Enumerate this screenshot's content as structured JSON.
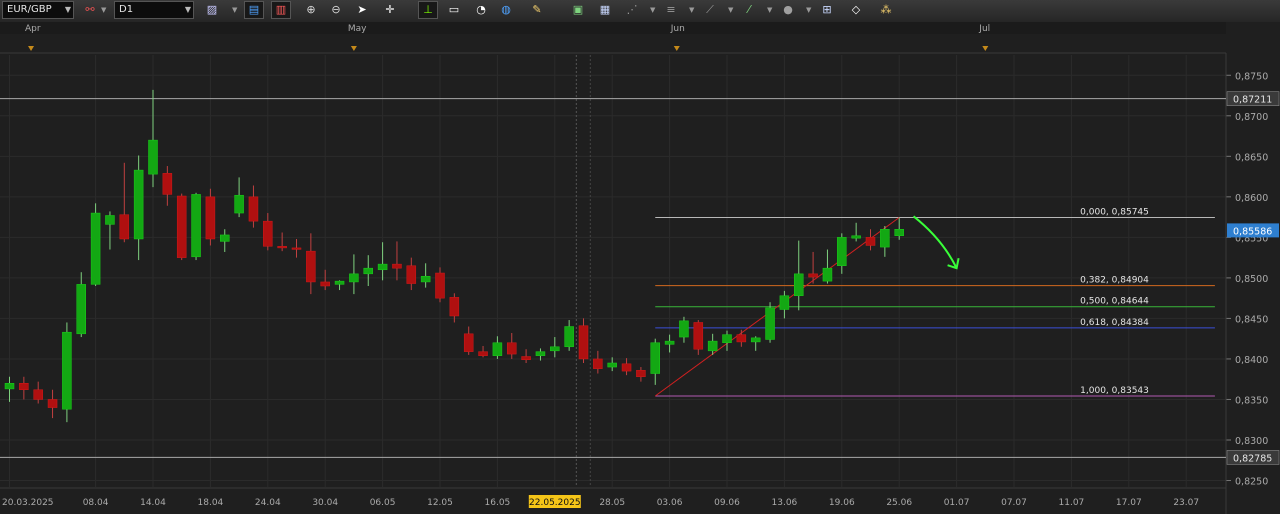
{
  "toolbar": {
    "symbol": "EUR/GBP",
    "timeframe": "D1",
    "icons": [
      {
        "name": "chart-type-icon",
        "glyph": "▨",
        "color": "#c9c9ff"
      },
      {
        "name": "indicator-rsi-icon",
        "glyph": "▤",
        "color": "#4fa3ff"
      },
      {
        "name": "indicator-macd-icon",
        "glyph": "▥",
        "color": "#ff5a5a"
      },
      {
        "name": "zoom-in-icon",
        "glyph": "⊕",
        "color": "#d8d8d8"
      },
      {
        "name": "zoom-out-icon",
        "glyph": "⊖",
        "color": "#d8d8d8"
      },
      {
        "name": "cursor-icon",
        "glyph": "➤",
        "color": "#ffffff"
      },
      {
        "name": "crosshair-icon",
        "glyph": "✛",
        "color": "#ffffff"
      },
      {
        "name": "price-level-icon",
        "glyph": "⊥",
        "color": "#7CFC00"
      },
      {
        "name": "note-icon",
        "glyph": "▭",
        "color": "#ffffff"
      },
      {
        "name": "alarm-icon",
        "glyph": "◔",
        "color": "#ffffff"
      },
      {
        "name": "globe-icon",
        "glyph": "◍",
        "color": "#4fa3ff"
      },
      {
        "name": "pencil-icon",
        "glyph": "✎",
        "color": "#f5d06e"
      },
      {
        "name": "image-icon",
        "glyph": "▣",
        "color": "#7ed37e"
      },
      {
        "name": "template-icon",
        "glyph": "▦",
        "color": "#c9d8ff"
      },
      {
        "name": "lines-icon",
        "glyph": "⋰",
        "color": "#9a9a9a"
      },
      {
        "name": "hlines-icon",
        "glyph": "≡",
        "color": "#9a9a9a"
      },
      {
        "name": "trendline-icon",
        "glyph": "⟋",
        "color": "#9a9a9a"
      },
      {
        "name": "brush-icon",
        "glyph": "⁄",
        "color": "#7ed37e"
      },
      {
        "name": "shapes-icon",
        "glyph": "●",
        "color": "#a0a0a0"
      },
      {
        "name": "objects-icon",
        "glyph": "⊞",
        "color": "#c9d8ff"
      },
      {
        "name": "eraser-icon",
        "glyph": "◇",
        "color": "#ffffff"
      },
      {
        "name": "signals-icon",
        "glyph": "⁂",
        "color": "#f5d06e"
      }
    ]
  },
  "chart_data": {
    "type": "candlestick",
    "colors": {
      "up": "#13a813",
      "down": "#b01010",
      "grid": "#2b2b2b",
      "axis_text": "#aaaaaa",
      "background": "#1f1f1f"
    },
    "ylim": [
      0.8242,
      0.8775
    ],
    "y_ticks": [
      "0,8250",
      "0,8300",
      "0,8350",
      "0,8400",
      "0,8450",
      "0,8500",
      "0,8550",
      "0,8600",
      "0,8650",
      "0,8700",
      "0,8750"
    ],
    "x_labels": [
      {
        "label": "20.03.2025",
        "index": 0
      },
      {
        "label": "08.04",
        "index": 6
      },
      {
        "label": "14.04",
        "index": 10
      },
      {
        "label": "18.04",
        "index": 14
      },
      {
        "label": "24.04",
        "index": 18
      },
      {
        "label": "30.04",
        "index": 22
      },
      {
        "label": "06.05",
        "index": 26
      },
      {
        "label": "12.05",
        "index": 30
      },
      {
        "label": "16.05",
        "index": 34
      },
      {
        "label": "22.05.2025",
        "index": 38,
        "highlight": true
      },
      {
        "label": "28.05",
        "index": 42
      },
      {
        "label": "03.06",
        "index": 46
      },
      {
        "label": "09.06",
        "index": 50
      },
      {
        "label": "13.06",
        "index": 54
      },
      {
        "label": "19.06",
        "index": 58
      },
      {
        "label": "25.06",
        "index": 62
      },
      {
        "label": "01.07",
        "index": 66
      },
      {
        "label": "07.07",
        "index": 70
      },
      {
        "label": "11.07",
        "index": 74
      },
      {
        "label": "17.07",
        "index": 78
      },
      {
        "label": "23.07",
        "index": 82
      }
    ],
    "month_markers": [
      {
        "label": "Apr",
        "index": 1.5
      },
      {
        "label": "May",
        "index": 24
      },
      {
        "label": "Jun",
        "index": 46.5
      },
      {
        "label": "Jul",
        "index": 68
      }
    ],
    "candles": [
      {
        "o": 0.8363,
        "h": 0.8378,
        "l": 0.8347,
        "c": 0.837
      },
      {
        "o": 0.837,
        "h": 0.8378,
        "l": 0.835,
        "c": 0.8362
      },
      {
        "o": 0.8362,
        "h": 0.8372,
        "l": 0.8345,
        "c": 0.835
      },
      {
        "o": 0.835,
        "h": 0.8362,
        "l": 0.8327,
        "c": 0.834
      },
      {
        "o": 0.8338,
        "h": 0.8445,
        "l": 0.8322,
        "c": 0.8433
      },
      {
        "o": 0.8431,
        "h": 0.8507,
        "l": 0.8427,
        "c": 0.8492
      },
      {
        "o": 0.8492,
        "h": 0.8592,
        "l": 0.849,
        "c": 0.858
      },
      {
        "o": 0.8566,
        "h": 0.8582,
        "l": 0.8535,
        "c": 0.8577
      },
      {
        "o": 0.8578,
        "h": 0.8642,
        "l": 0.8544,
        "c": 0.8548
      },
      {
        "o": 0.8548,
        "h": 0.8651,
        "l": 0.8522,
        "c": 0.8633
      },
      {
        "o": 0.8628,
        "h": 0.8732,
        "l": 0.8612,
        "c": 0.867
      },
      {
        "o": 0.8629,
        "h": 0.8638,
        "l": 0.8589,
        "c": 0.8603
      },
      {
        "o": 0.8601,
        "h": 0.8604,
        "l": 0.8522,
        "c": 0.8525
      },
      {
        "o": 0.8526,
        "h": 0.8605,
        "l": 0.8522,
        "c": 0.8603
      },
      {
        "o": 0.86,
        "h": 0.861,
        "l": 0.854,
        "c": 0.8548
      },
      {
        "o": 0.8545,
        "h": 0.856,
        "l": 0.8532,
        "c": 0.8553
      },
      {
        "o": 0.858,
        "h": 0.8624,
        "l": 0.8575,
        "c": 0.8602
      },
      {
        "o": 0.86,
        "h": 0.8614,
        "l": 0.8562,
        "c": 0.857
      },
      {
        "o": 0.857,
        "h": 0.858,
        "l": 0.8534,
        "c": 0.8539
      },
      {
        "o": 0.8539,
        "h": 0.8556,
        "l": 0.8533,
        "c": 0.8537
      },
      {
        "o": 0.8537,
        "h": 0.8548,
        "l": 0.8525,
        "c": 0.8536
      },
      {
        "o": 0.8533,
        "h": 0.8555,
        "l": 0.848,
        "c": 0.8495
      },
      {
        "o": 0.8495,
        "h": 0.851,
        "l": 0.8485,
        "c": 0.849
      },
      {
        "o": 0.8492,
        "h": 0.8497,
        "l": 0.8485,
        "c": 0.8496
      },
      {
        "o": 0.8495,
        "h": 0.8529,
        "l": 0.848,
        "c": 0.8505
      },
      {
        "o": 0.8505,
        "h": 0.8528,
        "l": 0.849,
        "c": 0.8512
      },
      {
        "o": 0.851,
        "h": 0.8544,
        "l": 0.8497,
        "c": 0.8517
      },
      {
        "o": 0.8517,
        "h": 0.8545,
        "l": 0.8497,
        "c": 0.8512
      },
      {
        "o": 0.8515,
        "h": 0.8525,
        "l": 0.8485,
        "c": 0.8493
      },
      {
        "o": 0.8495,
        "h": 0.8518,
        "l": 0.8488,
        "c": 0.8502
      },
      {
        "o": 0.8506,
        "h": 0.8513,
        "l": 0.847,
        "c": 0.8475
      },
      {
        "o": 0.8476,
        "h": 0.8481,
        "l": 0.8445,
        "c": 0.8453
      },
      {
        "o": 0.8431,
        "h": 0.844,
        "l": 0.8405,
        "c": 0.8409
      },
      {
        "o": 0.8409,
        "h": 0.8416,
        "l": 0.8402,
        "c": 0.8404
      },
      {
        "o": 0.8404,
        "h": 0.8428,
        "l": 0.84,
        "c": 0.842
      },
      {
        "o": 0.842,
        "h": 0.8432,
        "l": 0.84,
        "c": 0.8406
      },
      {
        "o": 0.8403,
        "h": 0.8412,
        "l": 0.8395,
        "c": 0.8399
      },
      {
        "o": 0.8404,
        "h": 0.8413,
        "l": 0.8398,
        "c": 0.8409
      },
      {
        "o": 0.841,
        "h": 0.8427,
        "l": 0.8402,
        "c": 0.8415
      },
      {
        "o": 0.8415,
        "h": 0.8448,
        "l": 0.841,
        "c": 0.844
      },
      {
        "o": 0.8441,
        "h": 0.845,
        "l": 0.8395,
        "c": 0.84
      },
      {
        "o": 0.84,
        "h": 0.841,
        "l": 0.8382,
        "c": 0.8388
      },
      {
        "o": 0.839,
        "h": 0.8402,
        "l": 0.8385,
        "c": 0.8395
      },
      {
        "o": 0.8394,
        "h": 0.8401,
        "l": 0.838,
        "c": 0.8385
      },
      {
        "o": 0.8386,
        "h": 0.839,
        "l": 0.8372,
        "c": 0.8378
      },
      {
        "o": 0.8382,
        "h": 0.8425,
        "l": 0.8368,
        "c": 0.842
      },
      {
        "o": 0.8418,
        "h": 0.843,
        "l": 0.8408,
        "c": 0.8422
      },
      {
        "o": 0.8427,
        "h": 0.8452,
        "l": 0.842,
        "c": 0.8447
      },
      {
        "o": 0.8445,
        "h": 0.8448,
        "l": 0.8405,
        "c": 0.8412
      },
      {
        "o": 0.841,
        "h": 0.8431,
        "l": 0.8405,
        "c": 0.8422
      },
      {
        "o": 0.842,
        "h": 0.8435,
        "l": 0.841,
        "c": 0.843
      },
      {
        "o": 0.843,
        "h": 0.8436,
        "l": 0.8415,
        "c": 0.8421
      },
      {
        "o": 0.8421,
        "h": 0.8428,
        "l": 0.841,
        "c": 0.8426
      },
      {
        "o": 0.8424,
        "h": 0.847,
        "l": 0.842,
        "c": 0.8463
      },
      {
        "o": 0.8461,
        "h": 0.8484,
        "l": 0.845,
        "c": 0.8478
      },
      {
        "o": 0.8478,
        "h": 0.8546,
        "l": 0.846,
        "c": 0.8505
      },
      {
        "o": 0.8505,
        "h": 0.8532,
        "l": 0.8493,
        "c": 0.8501
      },
      {
        "o": 0.8496,
        "h": 0.8535,
        "l": 0.8493,
        "c": 0.8512
      },
      {
        "o": 0.8515,
        "h": 0.8555,
        "l": 0.8505,
        "c": 0.855
      },
      {
        "o": 0.8549,
        "h": 0.8568,
        "l": 0.8545,
        "c": 0.8552
      },
      {
        "o": 0.855,
        "h": 0.856,
        "l": 0.8534,
        "c": 0.854
      },
      {
        "o": 0.8538,
        "h": 0.8564,
        "l": 0.8526,
        "c": 0.856
      },
      {
        "o": 0.8552,
        "h": 0.8574,
        "l": 0.8547,
        "c": 0.856
      }
    ],
    "hlines": [
      {
        "value": 0.87211,
        "label": "0,87211",
        "color": "#a9a9a9"
      },
      {
        "value": 0.82785,
        "label": "0,82785",
        "color": "#a9a9a9"
      }
    ],
    "current_price": {
      "value": 0.85586,
      "label": "0,85586"
    },
    "fibonacci": {
      "from_index": 45,
      "to_index": 62,
      "start_index": 45,
      "end_index": 84,
      "levels": [
        {
          "ratio": "0,000",
          "value": 0.85745,
          "label": "0,85745",
          "color": "#b8b8b8"
        },
        {
          "ratio": "0,382",
          "value": 0.84904,
          "label": "0,84904",
          "color": "#d2691e"
        },
        {
          "ratio": "0,500",
          "value": 0.84644,
          "label": "0,84644",
          "color": "#39b539"
        },
        {
          "ratio": "0,618",
          "value": 0.84384,
          "label": "0,84384",
          "color": "#3b4fd8"
        },
        {
          "ratio": "1,000",
          "value": 0.83543,
          "label": "0,83543",
          "color": "#b05ab0"
        }
      ]
    },
    "arrow": {
      "color": "#39ff39",
      "from": [
        63,
        0.8576
      ],
      "ctrl": [
        65,
        0.8548
      ],
      "to": [
        66,
        0.8512
      ]
    },
    "vline_index": 39.5
  }
}
